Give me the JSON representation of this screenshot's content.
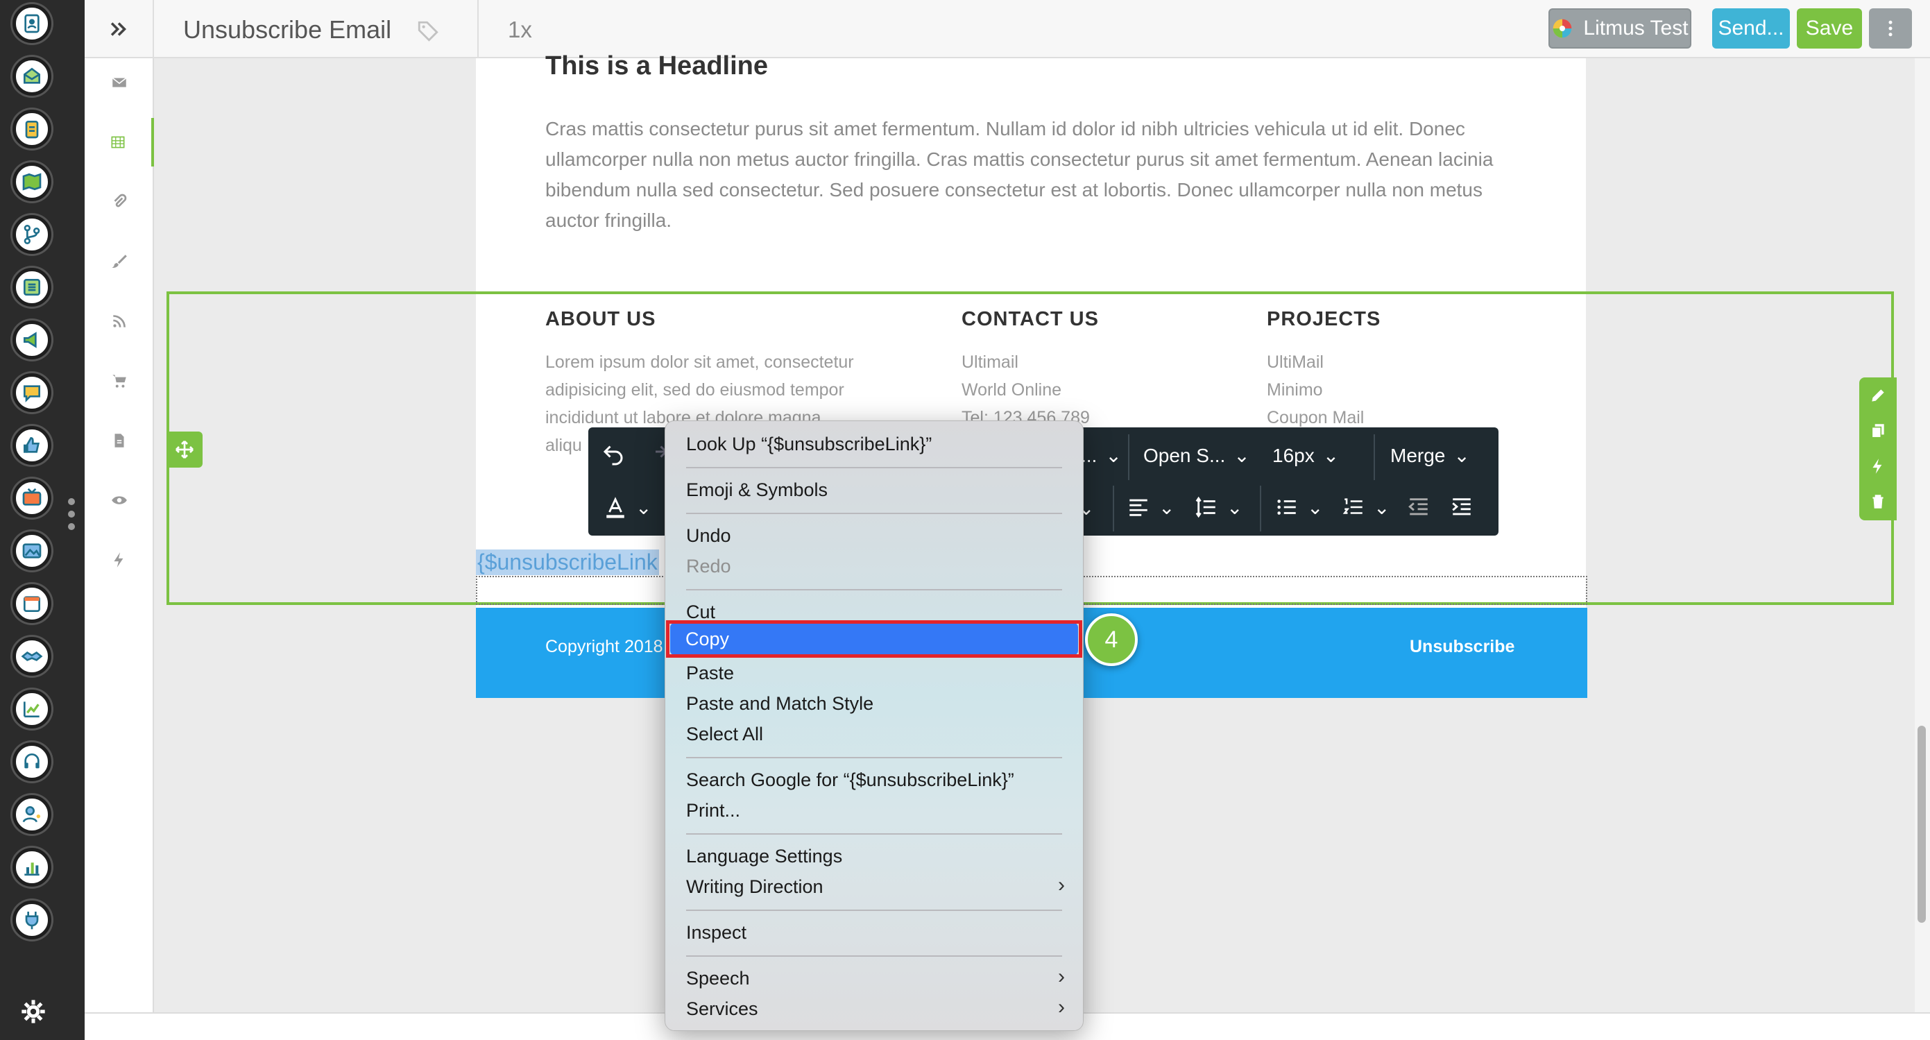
{
  "header": {
    "title": "Unsubscribe Email",
    "zoom": "1x",
    "litmus_label": "Litmus Test",
    "send_label": "Send...",
    "save_label": "Save"
  },
  "email": {
    "headline": "This is a Headline",
    "paragraph": "Cras mattis consectetur purus sit amet fermentum. Nullam id dolor id nibh ultricies vehicula ut id elit. Donec ullamcorper nulla non metus auctor fringilla. Cras mattis consectetur purus sit amet fermentum. Aenean lacinia bibendum nulla sed consectetur. Sed posuere consectetur est at lobortis. Donec ullamcorper nulla non metus auctor fringilla.",
    "about_heading": "ABOUT US",
    "about_line1": "Lorem ipsum dolor sit amet, consectetur",
    "about_line2": "adipisicing elit, sed do eiusmod tempor",
    "about_line3": "incididunt ut labore et dolore magna",
    "about_line4": "aliqu",
    "contact_heading": "CONTACT US",
    "contact_line1": "Ultimail",
    "contact_line2": "World Online",
    "contact_line3": "Tel: 123 456 789",
    "projects_heading": "PROJECTS",
    "projects_line1": "UltiMail",
    "projects_line2": "Minimo",
    "projects_line3": "Coupon Mail",
    "selected_text": "{$unsubscribeLink",
    "copyright": "Copyright 2018",
    "unsubscribe": "Unsubscribe"
  },
  "rte_toolbar": {
    "font_family": "Open S...",
    "font_size": "16px",
    "merge": "Merge",
    "truncated": "..."
  },
  "context_menu": {
    "look_up": "Look Up “{$unsubscribeLink}”",
    "emoji": "Emoji & Symbols",
    "undo": "Undo",
    "redo": "Redo",
    "cut": "Cut",
    "copy": "Copy",
    "paste": "Paste",
    "paste_match": "Paste and Match Style",
    "select_all": "Select All",
    "search_google": "Search Google for “{$unsubscribeLink}”",
    "print": "Print...",
    "language_settings": "Language Settings",
    "writing_direction": "Writing Direction",
    "inspect": "Inspect",
    "speech": "Speech",
    "services": "Services"
  },
  "step_badge": "4",
  "colors": {
    "accent_green": "#7cc242",
    "footer_blue": "#21a4ee",
    "highlight_red": "#e3242b",
    "menu_selection": "#3478f6"
  },
  "icons": {
    "rail": [
      "contacts-icon",
      "inbox-icon",
      "clipboard-icon",
      "map-icon",
      "branch-icon",
      "list-icon",
      "megaphone-icon",
      "chat-icon",
      "thumbs-up-icon",
      "tv-icon",
      "image-icon",
      "calendar-icon",
      "handshake-icon",
      "growth-chart-icon",
      "support-headset-icon",
      "user-star-icon",
      "bar-chart-icon",
      "plug-icon",
      "gear-icon"
    ],
    "side_toolbar": [
      "envelope-icon",
      "grid-icon",
      "paperclip-icon",
      "brush-icon",
      "rss-icon",
      "cart-icon",
      "document-icon",
      "eye-icon",
      "bolt-icon"
    ]
  }
}
